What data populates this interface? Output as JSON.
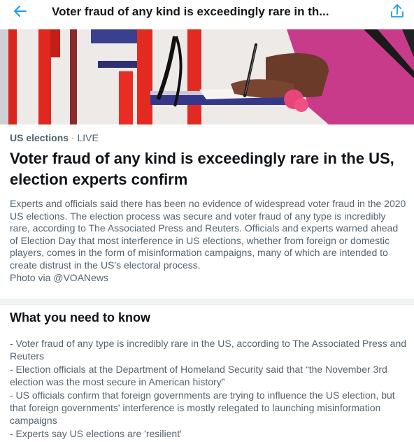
{
  "header": {
    "title": "Voter fraud of any kind is exceedingly rare in th...",
    "back_icon": "arrow-left-icon",
    "share_icon": "share-icon",
    "accent": "#1d9bf0"
  },
  "meta": {
    "topic": "US elections",
    "separator": " · ",
    "status": "LIVE"
  },
  "headline": "Voter fraud of any kind is exceedingly rare in the US, election experts confirm",
  "summary": {
    "text": "Experts and officials said there has been no evidence of widespread voter fraud in the 2020 US elections. The election process was secure and voter fraud of any type is incredibly rare, according to The Associated Press and Reuters. Officials and experts warned ahead of Election Day that most interference in US elections, whether from foreign or domestic players, comes in the form of misinformation campaigns, many of which are intended to create distrust in the US's electoral process.",
    "photo_credit": "Photo via @VOANews"
  },
  "need_to_know": {
    "title": "What you need to know",
    "items": [
      "- Voter fraud of any type is incredibly rare in the US, according to The Associated Press and Reuters",
      "- Election officials at the Department of Homeland Security said that “the November 3rd election was the most secure in American history”",
      "- US officials confirm that foreign governments are trying to influence the US election, but that foreign governments' interference is mostly relegated to launching misinformation campaigns",
      "- Experts say US elections are 'resilient'"
    ]
  }
}
